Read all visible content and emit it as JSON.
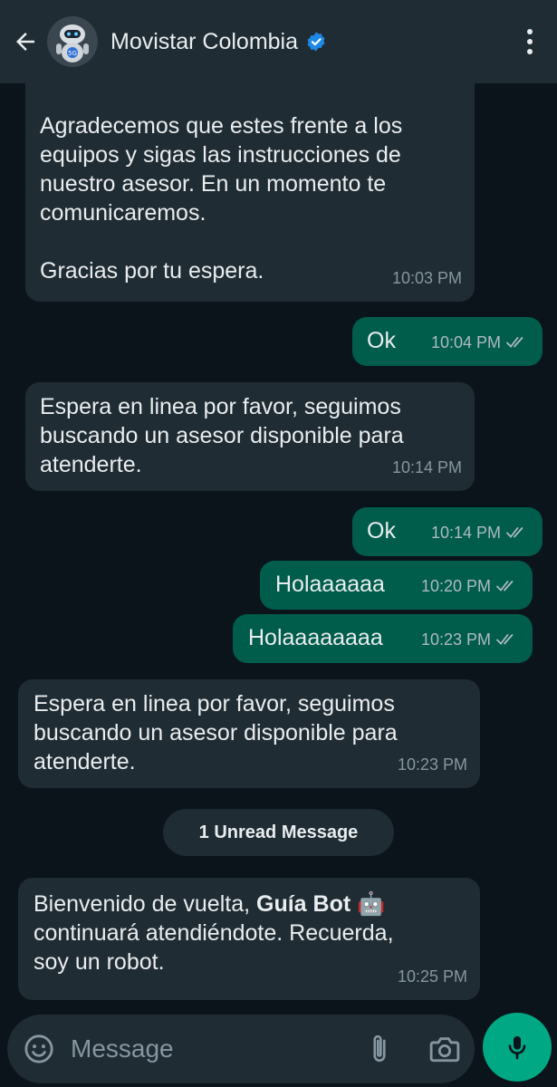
{
  "header": {
    "title": "Movistar Colombia",
    "back_icon": "arrow-left-icon",
    "verified_icon": "verified-badge-icon",
    "menu_icon": "more-vert-icon"
  },
  "messages": [
    {
      "dir": "in",
      "text": "Agradecemos que estes frente a los\nequipos y sigas las instrucciones de\nnuestro asesor. En un momento te\ncomunicaremos.\n\nGracias por tu espera.",
      "time": "10:03 PM"
    },
    {
      "dir": "out",
      "text": "Ok",
      "time": "10:04 PM"
    },
    {
      "dir": "in",
      "text": "Espera en linea por favor, seguimos\nbuscando un asesor disponible para\natenderte.",
      "time": "10:14 PM"
    },
    {
      "dir": "out",
      "text": "Ok",
      "time": "10:14 PM"
    },
    {
      "dir": "out",
      "text": "Holaaaaaa",
      "time": "10:20 PM"
    },
    {
      "dir": "out",
      "text": "Holaaaaaaaa",
      "time": "10:23 PM"
    },
    {
      "dir": "in",
      "text": "Espera en linea por favor, seguimos\nbuscando un asesor disponible para\natenderte.",
      "time": "10:23 PM"
    },
    {
      "dir": "in",
      "text_before": "Bienvenido de vuelta, ",
      "text_bold": "Guía Bot",
      "text_emoji": "🤖",
      "text_after": "\ncontinuará atendiéndote. Recuerda,\nsoy un robot.",
      "time": "10:25 PM"
    }
  ],
  "unread": "1 Unread Message",
  "composer": {
    "placeholder": "Message",
    "emoji_icon": "emoji-icon",
    "attach_icon": "paperclip-icon",
    "camera_icon": "camera-icon",
    "mic_icon": "mic-icon"
  },
  "colors": {
    "background": "#0b141a",
    "incoming": "#202c33",
    "outgoing": "#005c4b",
    "accent": "#00a884",
    "verified": "#1e88e5"
  }
}
